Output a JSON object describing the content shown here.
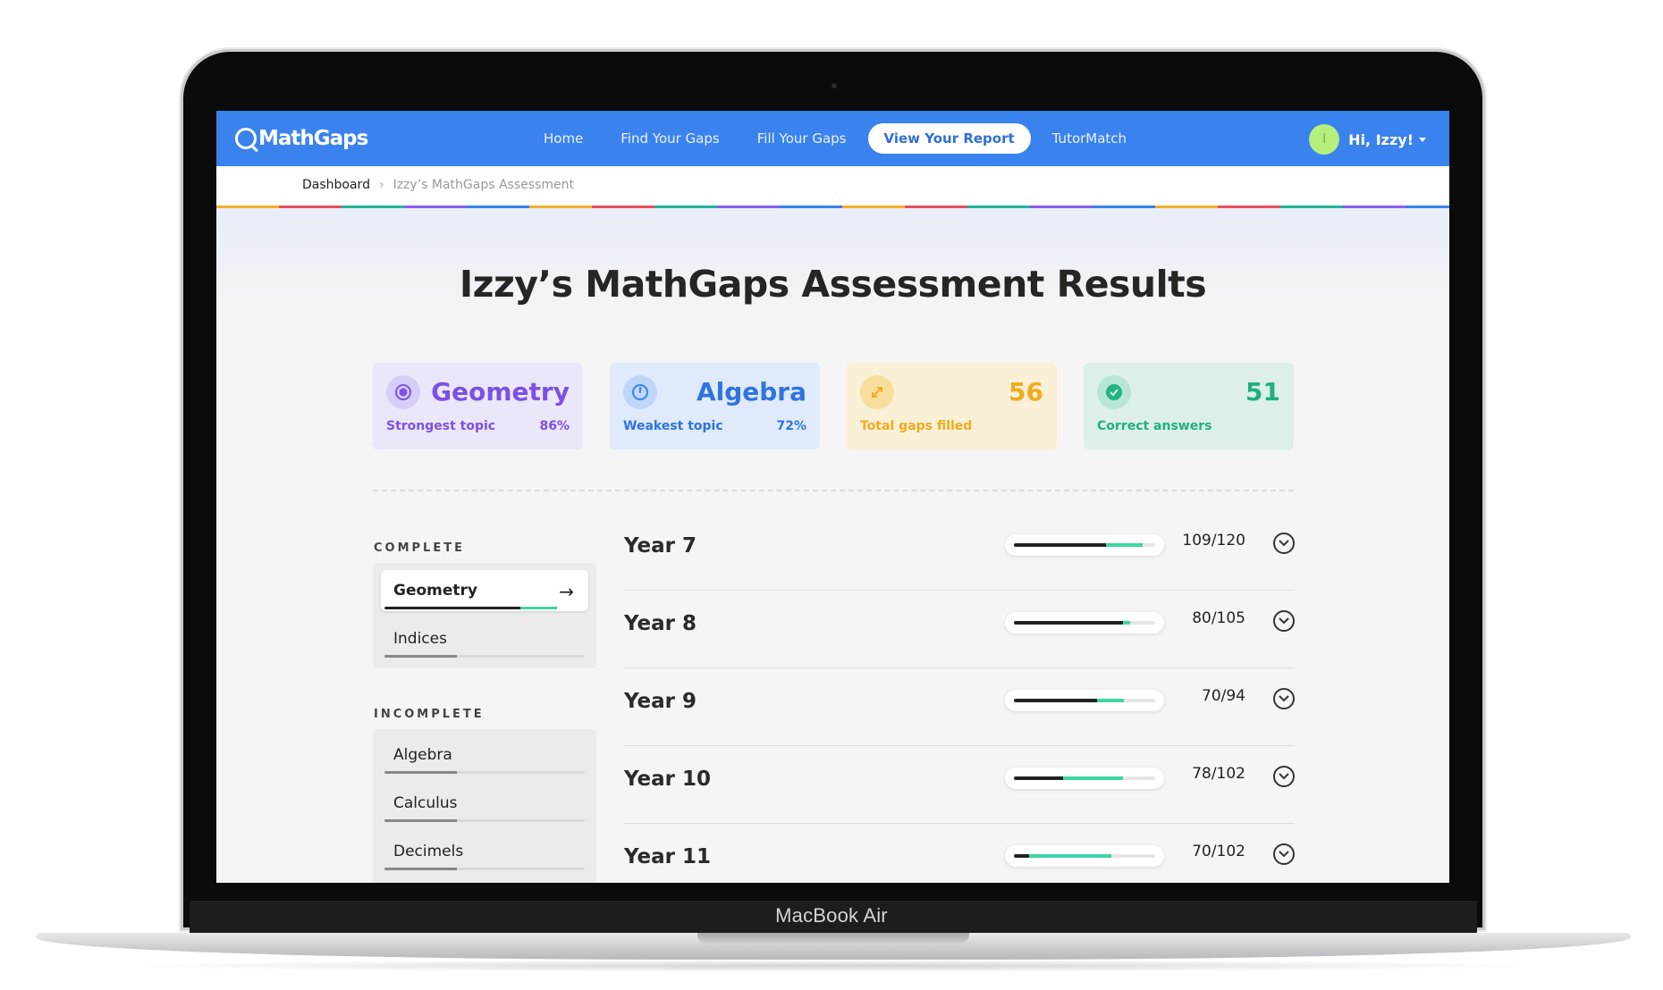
{
  "device": {
    "label": "MacBook Air"
  },
  "nav": {
    "logo": "MathGaps",
    "links": [
      "Home",
      "Find Your Gaps",
      "Fill Your Gaps",
      "View Your Report",
      "TutorMatch"
    ],
    "active_index": 3,
    "user": {
      "avatar_initial": "I",
      "greeting": "Hi, Izzy!"
    }
  },
  "breadcrumb": {
    "home": "Dashboard",
    "current": "Izzy’s MathGaps Assessment"
  },
  "title": "Izzy’s MathGaps Assessment Results",
  "stats": [
    {
      "value": "Geometry",
      "label": "Strongest topic",
      "percent": "86%",
      "icon": "target-icon",
      "color": "#7b50e6"
    },
    {
      "value": "Algebra",
      "label": "Weakest topic",
      "percent": "72%",
      "icon": "gauge-icon",
      "color": "#2f73e0"
    },
    {
      "value": "56",
      "label": "Total gaps filled",
      "percent": "",
      "icon": "expand-arrows-icon",
      "color": "#efac1f"
    },
    {
      "value": "51",
      "label": "Correct answers",
      "percent": "",
      "icon": "check-circle-icon",
      "color": "#1fb07f"
    }
  ],
  "sidebar": {
    "complete_label": "COMPLETE",
    "incomplete_label": "INCOMPLETE",
    "complete": [
      {
        "name": "Geometry",
        "progress": 0.86,
        "selected": true
      },
      {
        "name": "Indices",
        "progress": 0.4,
        "selected": false
      }
    ],
    "incomplete": [
      {
        "name": "Algebra",
        "progress": 0.4
      },
      {
        "name": "Calculus",
        "progress": 0.4
      },
      {
        "name": "Decimels",
        "progress": 0.4
      }
    ]
  },
  "years": [
    {
      "name": "Year 7",
      "score": "109/120",
      "dark": 0.65,
      "green": 0.91
    },
    {
      "name": "Year 8",
      "score": "80/105",
      "dark": 0.77,
      "green": 0.82
    },
    {
      "name": "Year 9",
      "score": "70/94",
      "dark": 0.59,
      "green": 0.78
    },
    {
      "name": "Year 10",
      "score": "78/102",
      "dark": 0.35,
      "green": 0.77
    },
    {
      "name": "Year 11",
      "score": "70/102",
      "dark": 0.11,
      "green": 0.69
    }
  ]
}
